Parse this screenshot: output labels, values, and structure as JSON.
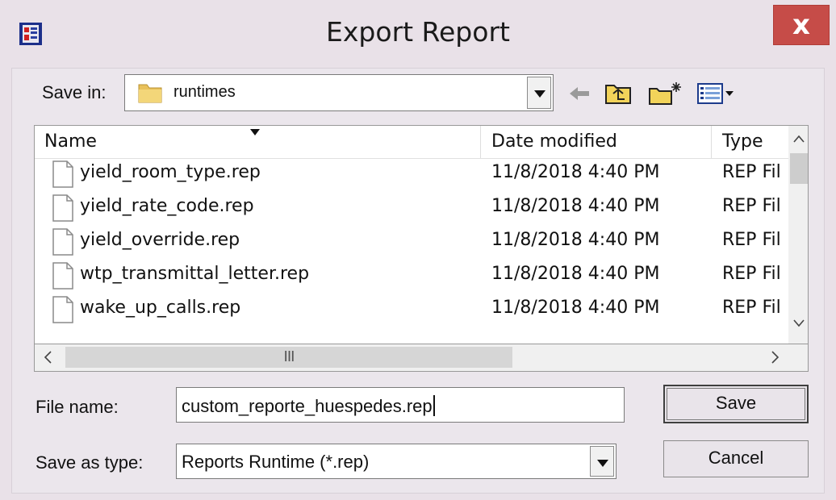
{
  "window": {
    "title": "Export Report",
    "close_label": "x"
  },
  "save_in": {
    "label": "Save in:",
    "value": "runtimes",
    "icon": "folder-icon"
  },
  "toolbar": {
    "icons": [
      "back-arrow-icon",
      "up-folder-icon",
      "new-folder-icon",
      "view-menu-icon"
    ]
  },
  "file_list": {
    "columns": [
      "Name",
      "Date modified",
      "Type"
    ],
    "rows": [
      {
        "name": "yield_room_type.rep",
        "date": "11/8/2018 4:40 PM",
        "type": "REP Fil"
      },
      {
        "name": "yield_rate_code.rep",
        "date": "11/8/2018 4:40 PM",
        "type": "REP Fil"
      },
      {
        "name": "yield_override.rep",
        "date": "11/8/2018 4:40 PM",
        "type": "REP Fil"
      },
      {
        "name": "wtp_transmittal_letter.rep",
        "date": "11/8/2018 4:40 PM",
        "type": "REP Fil"
      },
      {
        "name": "wake_up_calls.rep",
        "date": "11/8/2018 4:40 PM",
        "type": "REP Fil"
      }
    ],
    "scroll_up_label": "^",
    "scroll_down_label": "v",
    "scroll_left_label": "<",
    "scroll_right_label": ">",
    "hscroll_grip": "III"
  },
  "file_name": {
    "label": "File name:",
    "value": "custom_reporte_huespedes.rep"
  },
  "save_as_type": {
    "label": "Save as type:",
    "value": "Reports Runtime (*.rep)"
  },
  "buttons": {
    "save_label": "Save",
    "cancel_label": "Cancel"
  },
  "colors": {
    "dialog_bg": "#e9e1e8",
    "close_button": "#c64c48"
  }
}
